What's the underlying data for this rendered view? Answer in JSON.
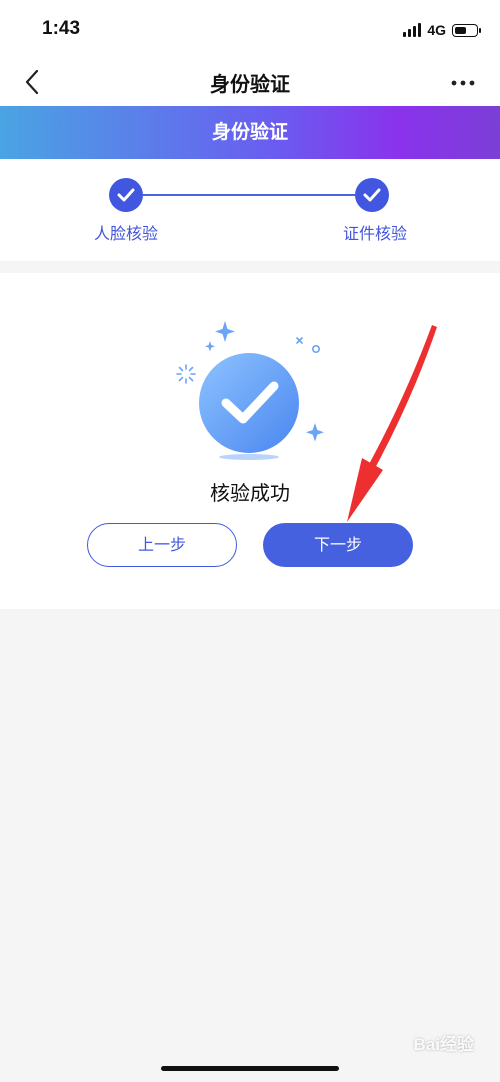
{
  "status_bar": {
    "time": "1:43",
    "network": "4G",
    "icons": [
      "signal-icon",
      "battery-icon"
    ]
  },
  "nav": {
    "title": "身份验证",
    "back_icon": "chevron-left-icon",
    "more_icon": "more-dots-icon"
  },
  "banner": {
    "title": "身份验证",
    "gradient_colors": [
      "#4aa4e3",
      "#6a5cf0",
      "#8a32ec",
      "#7b3fd6"
    ]
  },
  "steps": {
    "items": [
      {
        "label": "人脸核验",
        "status": "done"
      },
      {
        "label": "证件核验",
        "status": "done"
      }
    ],
    "accent_color": "#4257df"
  },
  "result": {
    "message": "核验成功",
    "icon": "success-check-icon"
  },
  "buttons": {
    "prev_label": "上一步",
    "next_label": "下一步",
    "primary_color": "#4561e0"
  },
  "annotation": {
    "type": "red-arrow",
    "color": "#ee2f2f",
    "points_to": "next-step-button"
  },
  "watermark": {
    "text": "Bai经验"
  }
}
